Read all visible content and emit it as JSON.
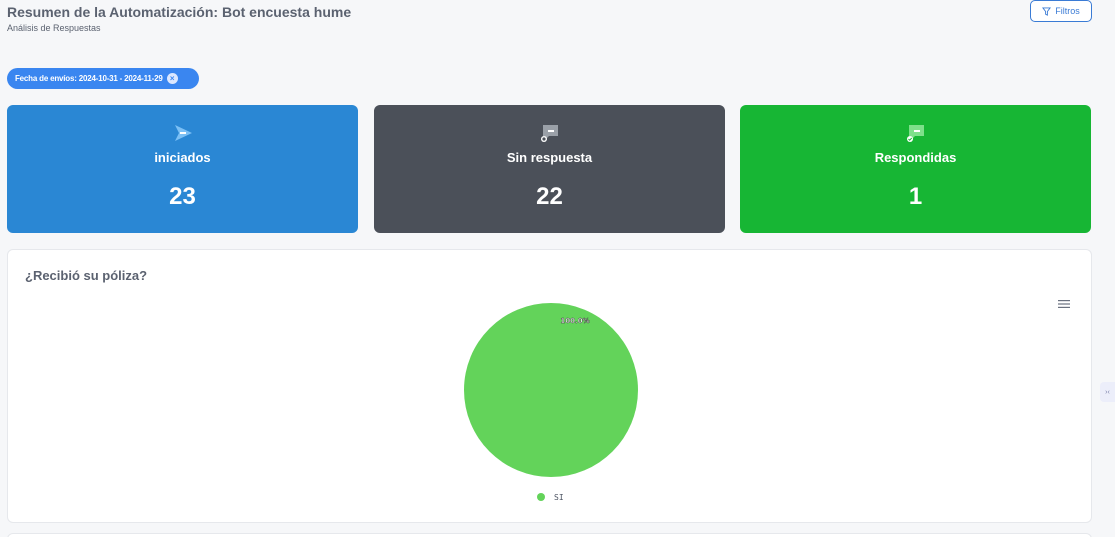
{
  "header": {
    "title": "Resumen de la Automatización: Bot encuesta hume",
    "subtitle": "Análisis de Respuestas",
    "filter_label": "Filtros"
  },
  "filters": {
    "date_chip": "Fecha de envíos: 2024-10-31 - 2024-11-29"
  },
  "stats": [
    {
      "label": "iniciados",
      "value": "23",
      "color": "#2a87d4",
      "icon": "send-icon"
    },
    {
      "label": "Sin respuesta",
      "value": "22",
      "color": "#4b5059",
      "icon": "message-x-icon"
    },
    {
      "label": "Respondidas",
      "value": "1",
      "color": "#17b634",
      "icon": "message-check-icon"
    }
  ],
  "question": {
    "title": "¿Recibió su póliza?"
  },
  "chart_data": {
    "type": "pie",
    "title": "¿Recibió su póliza?",
    "slices": [
      {
        "label": "SI",
        "value": 1,
        "percent_label": "100.0%",
        "color": "#63d35a"
      }
    ],
    "legend_position": "bottom"
  },
  "side_widget": {
    "icon": "chevron-collapse-icon"
  }
}
